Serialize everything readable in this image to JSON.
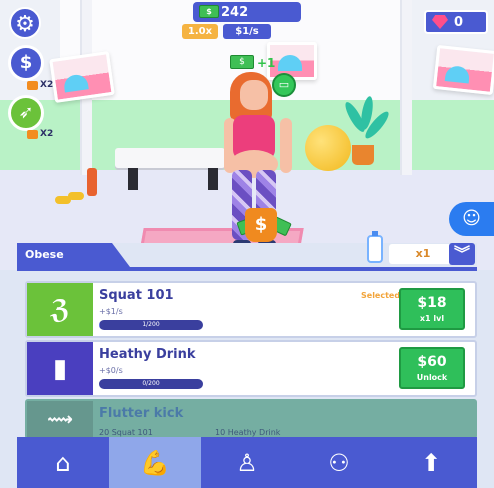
{
  "hud": {
    "money": "242",
    "multiplier": "1.0x",
    "rate": "$1/s",
    "gems": "0",
    "boosts": [
      {
        "name": "money-boost",
        "badge": "X2"
      },
      {
        "name": "speed-boost",
        "badge": "X2"
      }
    ],
    "floating_gain": "+1"
  },
  "scene": {
    "money_bag_symbol": "$"
  },
  "panel": {
    "tab_label": "Obese",
    "multiplier_label": "x1",
    "exercises": [
      {
        "title": "Squat 101",
        "subtitle": "+$1/s",
        "progress_text": "1/200",
        "progress_fraction": 0.005,
        "status": "Selected",
        "price": "$18",
        "action": "x1 lvl",
        "icon": "squat-icon",
        "color": "#6bc23a"
      },
      {
        "title": "Heathy Drink",
        "subtitle": "+$0/s",
        "progress_text": "0/200",
        "progress_fraction": 0,
        "price": "$60",
        "action": "Unlock",
        "icon": "drink-bottle-icon",
        "color": "#4a3fbf"
      },
      {
        "title": "Flutter kick",
        "requirement_1": "20 Squat 101",
        "requirement_2": "10 Heathy Drink",
        "icon": "flutter-kick-icon",
        "locked": true
      }
    ]
  },
  "nav": {
    "items": [
      "home-icon",
      "muscle-icon",
      "trainer-icon",
      "community-icon",
      "upgrade-icon"
    ],
    "active": "muscle-icon"
  },
  "colors": {
    "primary": "#4a5ad1",
    "buy_green": "#2fbf5a",
    "accent_orange": "#f5b342"
  }
}
